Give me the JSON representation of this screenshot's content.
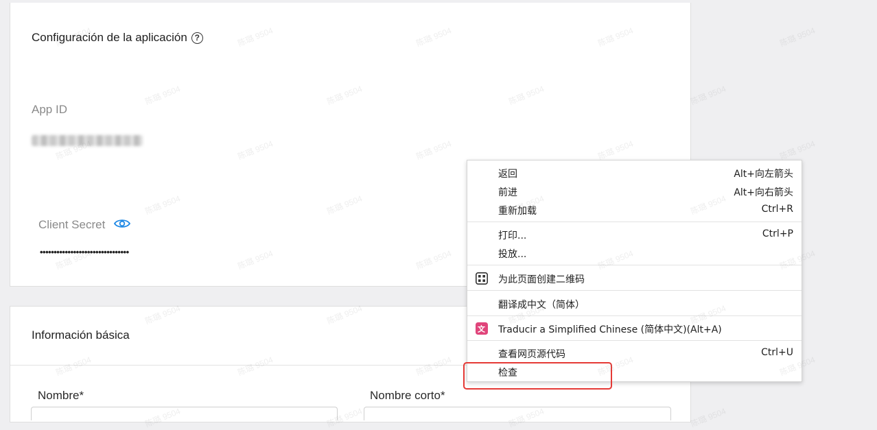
{
  "config": {
    "title": "Configuración de la aplicación",
    "help_symbol": "?",
    "app_id_label": "App ID",
    "client_secret_label": "Client Secret",
    "client_secret_value": "••••••••••••••••••••••••••••••••"
  },
  "basic_info": {
    "title": "Información básica",
    "nombre_label": "Nombre*",
    "nombre_corto_label": "Nombre corto*"
  },
  "context_menu": {
    "back_label": "返回",
    "back_shortcut": "Alt+向左箭头",
    "forward_label": "前进",
    "forward_shortcut": "Alt+向右箭头",
    "reload_label": "重新加载",
    "reload_shortcut": "Ctrl+R",
    "print_label": "打印...",
    "print_shortcut": "Ctrl+P",
    "cast_label": "投放...",
    "qr_label": "为此页面创建二维码",
    "translate_label": "翻译成中文（简体）",
    "traducir_label": "Traducir a Simplified Chinese (简体中文)(Alt+A)",
    "view_source_label": "查看网页源代码",
    "view_source_shortcut": "Ctrl+U",
    "inspect_label": "检查"
  },
  "watermark_text": "陈璐 9504",
  "colors": {
    "accent_blue": "#1e88e5",
    "highlight_red": "#e53935",
    "translate_icon_pink": "#e0457b"
  },
  "icons": {
    "help": "question-circle-icon",
    "eye": "eye-icon",
    "qr": "qr-code-icon",
    "translate": "translate-icon"
  }
}
